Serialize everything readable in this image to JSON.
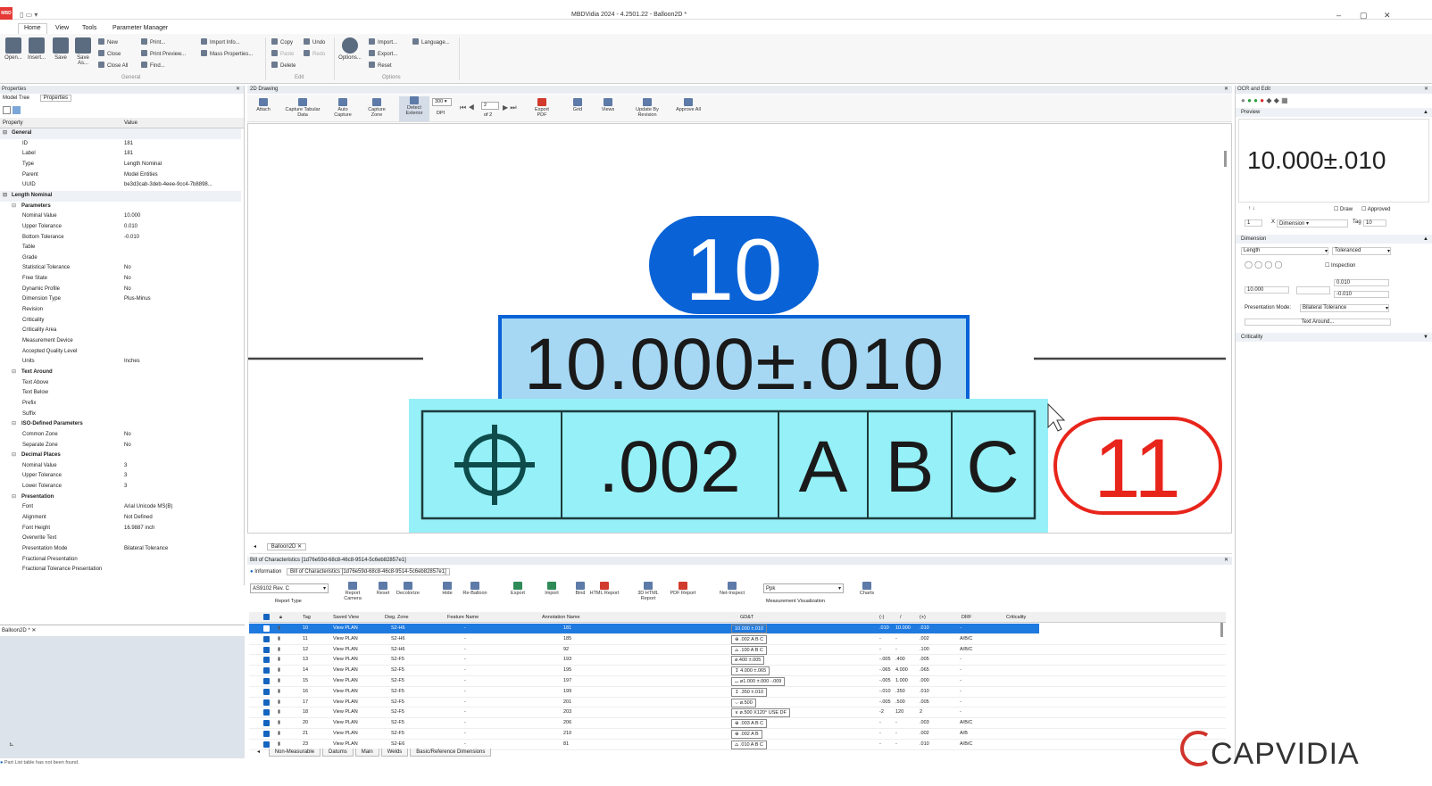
{
  "app": {
    "window_title": "MBDVidia 2024 - 4.2501.22 - Balloon2D *",
    "logo_text": "MBD",
    "min": "–",
    "max": "▢",
    "close": "✕"
  },
  "menu": [
    "Home",
    "View",
    "Tools",
    "Parameter Manager"
  ],
  "ribbon": {
    "big": [
      "Open...",
      "Insert...",
      "Save",
      "Save As..."
    ],
    "small_col1": [
      "New",
      "Close",
      "Close All"
    ],
    "small_col2": [
      "Print...",
      "Print Preview...",
      "Find..."
    ],
    "small_col3": [
      "Import Info...",
      "Mass Properties..."
    ],
    "edit": [
      "Copy",
      "Paste",
      "Delete",
      "Undo",
      "Redo"
    ],
    "options_big": "Options...",
    "options_small": [
      "Import...",
      "Export...",
      "Reset"
    ],
    "language": "Language...",
    "groups": [
      "General",
      "Edit",
      "Options"
    ]
  },
  "properties": {
    "title": "Properties",
    "tabs": [
      "Model Tree",
      "Properties"
    ],
    "col_property": "Property",
    "col_value": "Value",
    "rows": [
      {
        "k": "General",
        "v": "",
        "kind": "sec"
      },
      {
        "k": "ID",
        "v": "181"
      },
      {
        "k": "Label",
        "v": "181"
      },
      {
        "k": "Type",
        "v": "Length Nominal"
      },
      {
        "k": "Parent",
        "v": "Model Entities"
      },
      {
        "k": "UUID",
        "v": "be3d3cab-3deb-4eee-9cc4-7b8898..."
      },
      {
        "k": "Length Nominal",
        "v": "",
        "kind": "sec"
      },
      {
        "k": "Parameters",
        "v": "",
        "kind": "cat"
      },
      {
        "k": "Nominal Value",
        "v": "10.000"
      },
      {
        "k": "Upper Tolerance",
        "v": "0.010"
      },
      {
        "k": "Bottom Tolerance",
        "v": "-0.010"
      },
      {
        "k": "Table",
        "v": ""
      },
      {
        "k": "Grade",
        "v": ""
      },
      {
        "k": "Statistical Tolerance",
        "v": "No"
      },
      {
        "k": "Free State",
        "v": "No"
      },
      {
        "k": "Dynamic Profile",
        "v": "No"
      },
      {
        "k": "Dimension Type",
        "v": "Plus-Minus"
      },
      {
        "k": "Revision",
        "v": ""
      },
      {
        "k": "Criticality",
        "v": ""
      },
      {
        "k": "Criticality Area",
        "v": ""
      },
      {
        "k": "Measurement Device",
        "v": ""
      },
      {
        "k": "Accepted Quality Level",
        "v": ""
      },
      {
        "k": "Units",
        "v": "Inches"
      },
      {
        "k": "Text Around",
        "v": "",
        "kind": "cat"
      },
      {
        "k": "Text Above",
        "v": ""
      },
      {
        "k": "Text Below",
        "v": ""
      },
      {
        "k": "Prefix",
        "v": ""
      },
      {
        "k": "Suffix",
        "v": ""
      },
      {
        "k": "ISO-Defined Parameters",
        "v": "",
        "kind": "cat"
      },
      {
        "k": "Common Zone",
        "v": "No"
      },
      {
        "k": "Separate Zone",
        "v": "No"
      },
      {
        "k": "Decimal Places",
        "v": "",
        "kind": "cat"
      },
      {
        "k": "Nominal Value",
        "v": "3"
      },
      {
        "k": "Upper Tolerance",
        "v": "3"
      },
      {
        "k": "Lower Tolerance",
        "v": "3"
      },
      {
        "k": "Presentation",
        "v": "",
        "kind": "cat"
      },
      {
        "k": "Font",
        "v": "Arial Unicode MS(B)"
      },
      {
        "k": "Alignment",
        "v": "Not Defined"
      },
      {
        "k": "Font Height",
        "v": "16.9887 inch"
      },
      {
        "k": "Overwrite Text",
        "v": ""
      },
      {
        "k": "Presentation Mode",
        "v": "Bilateral Tolerance"
      },
      {
        "k": "Fractional Presentation",
        "v": ""
      },
      {
        "k": "Fractional Tolerance Presentation",
        "v": ""
      }
    ]
  },
  "mini_panel_title": "Balloon2D *",
  "drawing": {
    "title": "2D Drawing",
    "tools": [
      "Attach",
      "Capture Tabular Data",
      "Auto Capture",
      "Capture Zone",
      "Detect Exterior",
      "DPI",
      "Export PDF",
      "Grid",
      "Views",
      "Update By Revision",
      "Approve All"
    ],
    "dpi": "300",
    "page": "2",
    "of_pages": "of 2",
    "balloon_top": "10",
    "dimension_text": "10.000±.010",
    "fcf_symbol": "⊕",
    "fcf_tol": ".002",
    "fcf_datums": [
      "A",
      "B",
      "C"
    ],
    "balloon_right": "11",
    "doc_tab": "Balloon2D"
  },
  "boc": {
    "title": "Bill of Characteristics [1d76e59d-68c8-46c8-9514-5c6eb82857e1]",
    "tabs": [
      "Information",
      "Bill of Characteristics [1d76e59d-68c8-46c8-9514-5c6eb82857e1]"
    ],
    "report_select": "AS9102 Rev. C",
    "toolbar": [
      "Report Type",
      "Report Camera",
      "Reset",
      "Decolorize",
      "Hide",
      "Re-Balloon",
      "Export",
      "Import",
      "Bind",
      "HTML Report",
      "3D HTML Report",
      "PDF Report",
      "Net-Inspect",
      "Measurement Visualization",
      "Charts"
    ],
    "vis_select": "Ppk",
    "headers": [
      "Tag",
      "Saved View",
      "Dwg. Zone",
      "Feature Name",
      "Annotation Name",
      "GD&T",
      "(-)",
      "/",
      "(+)",
      "DRF",
      "Criticality"
    ],
    "rows": [
      {
        "tag": "10",
        "view": "View PLAN",
        "zone": "S2-H6",
        "feat": "-",
        "ann": "181",
        "gdt": "10.000 ±.010",
        "m": ".010",
        "s": "10.000",
        "p": ".010",
        "drf": "-",
        "sel": true
      },
      {
        "tag": "11",
        "view": "View PLAN",
        "zone": "S2-H6",
        "feat": "-",
        "ann": "185",
        "gdt": "⊕ .002 A B C",
        "m": "-",
        "s": "-",
        "p": ".002",
        "drf": "A/B/C"
      },
      {
        "tag": "12",
        "view": "View PLAN",
        "zone": "S2-H6",
        "feat": "-",
        "ann": "92",
        "gdt": "⌓ .100 A B C",
        "m": "-",
        "s": "-",
        "p": ".100",
        "drf": "A/B/C"
      },
      {
        "tag": "13",
        "view": "View PLAN",
        "zone": "S2-F5",
        "feat": "-",
        "ann": "193",
        "gdt": "ø.400 ±.005",
        "m": "-.005",
        "s": ".400",
        "p": ".005",
        "drf": "-"
      },
      {
        "tag": "14",
        "view": "View PLAN",
        "zone": "S2-F5",
        "feat": "-",
        "ann": "195",
        "gdt": "↧ 4.000 ±.065",
        "m": "-.065",
        "s": "4.000",
        "p": ".065",
        "drf": "-"
      },
      {
        "tag": "15",
        "view": "View PLAN",
        "zone": "S2-F5",
        "feat": "-",
        "ann": "197",
        "gdt": "⌴ ø1.000 ±.000 -.009",
        "m": "-.005",
        "s": "1.000",
        "p": ".000",
        "drf": "-"
      },
      {
        "tag": "16",
        "view": "View PLAN",
        "zone": "S2-F5",
        "feat": "-",
        "ann": "199",
        "gdt": "↧ .350 ±.010",
        "m": "-.010",
        "s": ".350",
        "p": ".010",
        "drf": "-"
      },
      {
        "tag": "17",
        "view": "View PLAN",
        "zone": "S2-F5",
        "feat": "-",
        "ann": "201",
        "gdt": "⌵ ø.500",
        "m": "-.005",
        "s": ".500",
        "p": ".005",
        "drf": "-"
      },
      {
        "tag": "18",
        "view": "View PLAN",
        "zone": "S2-F5",
        "feat": "-",
        "ann": "203",
        "gdt": "∨ ø.500 X120° USE DF",
        "m": "-2",
        "s": "120",
        "p": "2",
        "drf": "-"
      },
      {
        "tag": "20",
        "view": "View PLAN",
        "zone": "S2-F5",
        "feat": "-",
        "ann": "206",
        "gdt": "⊕ .003 A B C",
        "m": "-",
        "s": "-",
        "p": ".003",
        "drf": "A/B/C"
      },
      {
        "tag": "21",
        "view": "View PLAN",
        "zone": "S2-F5",
        "feat": "-",
        "ann": "210",
        "gdt": "⊕ .002 A B",
        "m": "-",
        "s": "-",
        "p": ".002",
        "drf": "A/B"
      },
      {
        "tag": "23",
        "view": "View PLAN",
        "zone": "S2-E6",
        "feat": "-",
        "ann": "81",
        "gdt": "⌓ .010 A B C",
        "m": "-",
        "s": "-",
        "p": ".010",
        "drf": "A/B/C"
      }
    ],
    "bottom_tabs": [
      "Non-Measurable",
      "Datums",
      "Main",
      "Welds",
      "Basic/Reference Dimensions"
    ]
  },
  "ocr": {
    "title": "OCR and Edit",
    "preview_label": "Preview",
    "preview_text": "10.000±.010",
    "draw": "Draw",
    "approved": "Approved",
    "count": "1",
    "x": "X",
    "type_select": "Dimension",
    "tag_label": "Tag",
    "tag_value": "10",
    "dimension_label": "Dimension",
    "dim_type": "Length",
    "tol_type": "Toleranced",
    "inspection": "Inspection",
    "nominal": "10.000",
    "upper": "0.010",
    "lower": "-0.010",
    "presentation_label": "Presentation Mode:",
    "presentation_value": "Bilateral Tolerance",
    "text_around": "Text Around...",
    "criticality_label": "Criticality"
  },
  "status": "Part List table has not been found.",
  "brand": "CAPVIDIA",
  "colors": {
    "balloon_blue": "#0a63d6",
    "dim_fill": "#a6d8f4",
    "fcf_fill": "#96f0f8",
    "balloon_red": "#e8251b",
    "selection": "#1f7ae0"
  }
}
